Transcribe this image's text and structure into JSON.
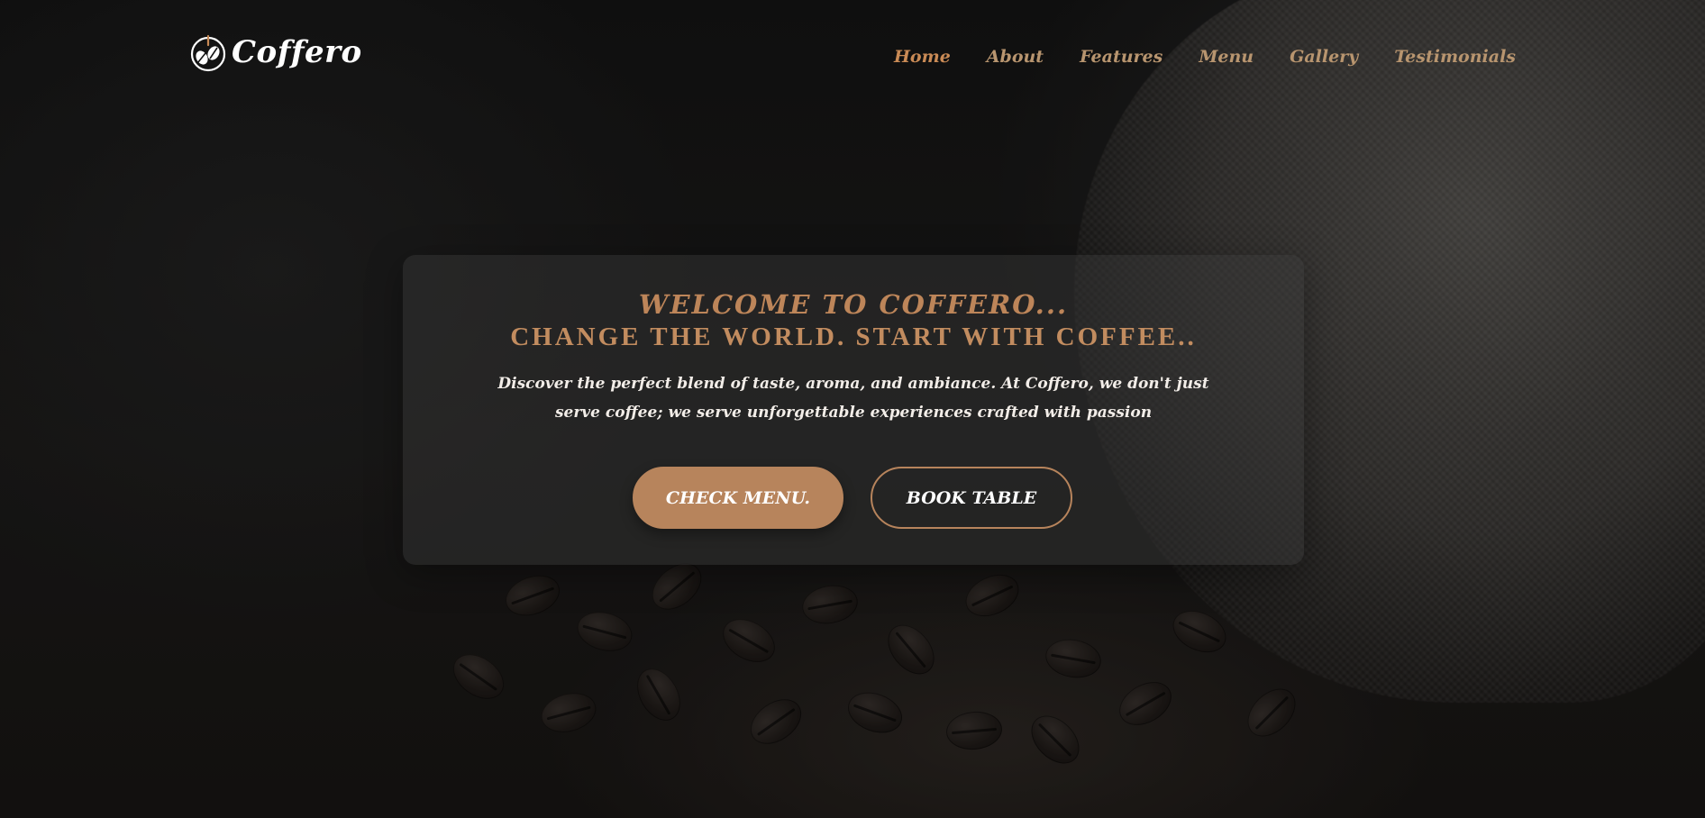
{
  "brand": {
    "name": "Coffero",
    "icon": "coffee-beans-icon",
    "accent_color": "#b7845c"
  },
  "nav": {
    "items": [
      {
        "label": "Home",
        "active": true
      },
      {
        "label": "About",
        "active": false
      },
      {
        "label": "Features",
        "active": false
      },
      {
        "label": "Menu",
        "active": false
      },
      {
        "label": "Gallery",
        "active": false
      },
      {
        "label": "Testimonials",
        "active": false
      }
    ]
  },
  "hero": {
    "welcome": "WELCOME TO COFFERO...",
    "tagline": "CHANGE THE WORLD. START WITH COFFEE..",
    "description": "Discover the perfect blend of taste, aroma, and ambiance. At Coffero, we don't just serve coffee; we serve unforgettable experiences crafted with passion",
    "primary_button": "CHECK MENU.",
    "secondary_button": "BOOK TABLE"
  }
}
